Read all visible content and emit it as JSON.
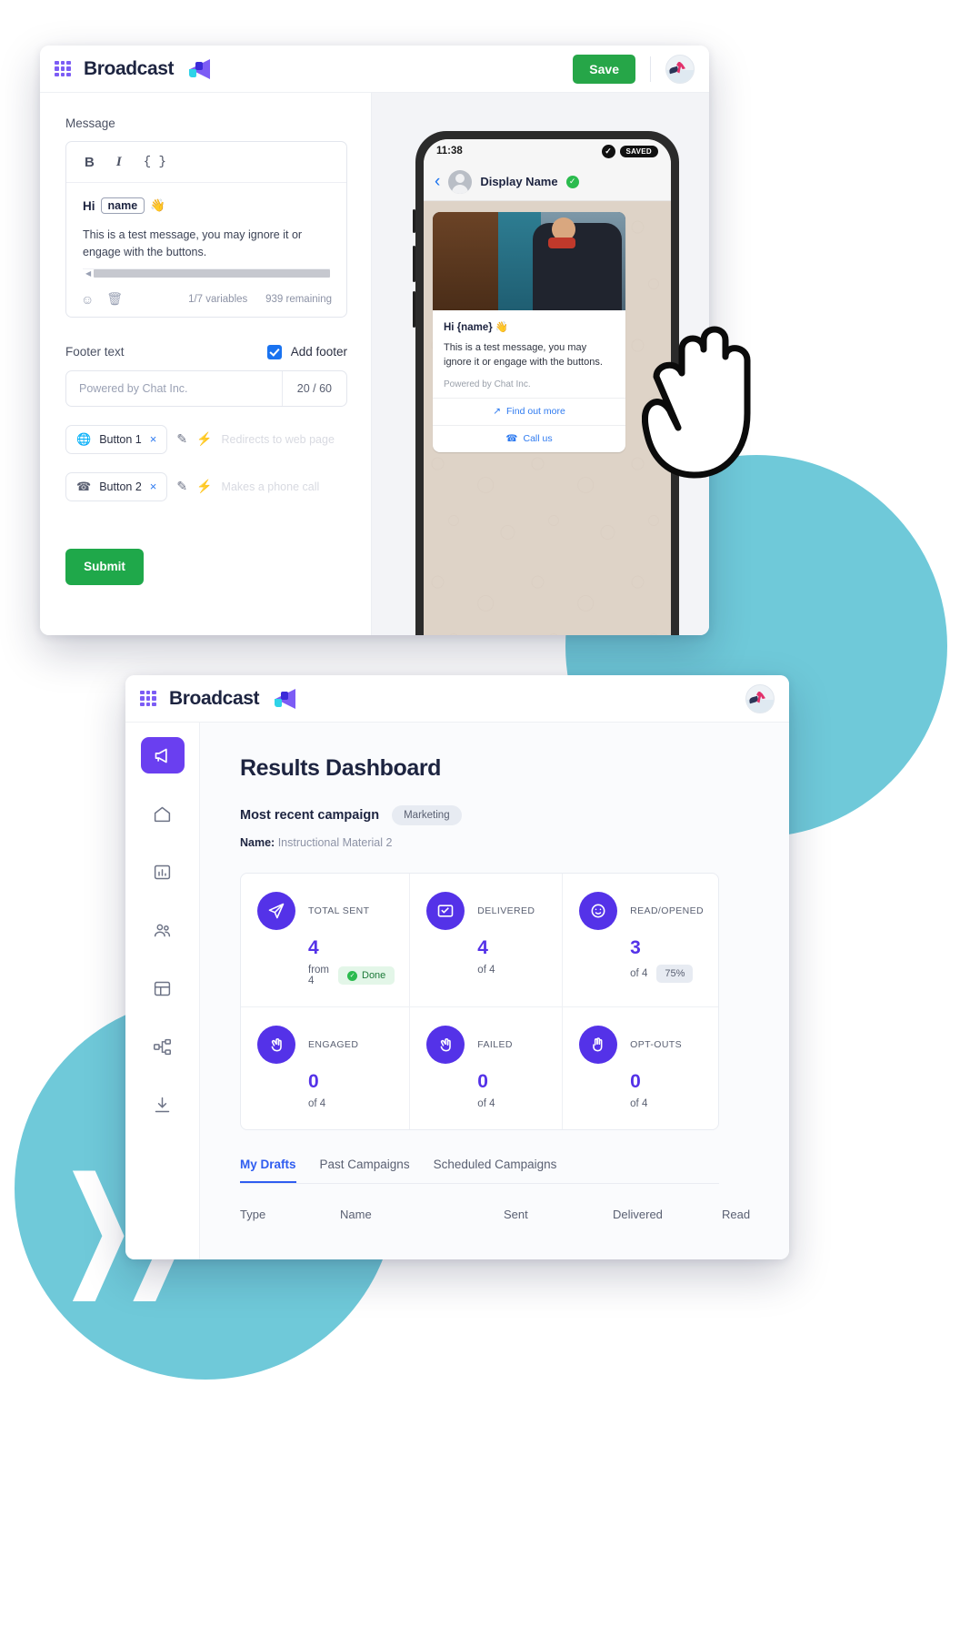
{
  "composer": {
    "titlebar": {
      "brand": "Broadcast",
      "grid_icon": "apps-grid-icon",
      "logo_icon": "megaphone-icon",
      "save_label": "Save",
      "avatar_icon": "user-avatar-skier"
    },
    "message_label": "Message",
    "toolbar": {
      "bold": "B",
      "italic": "I",
      "variables": "{ }"
    },
    "message": {
      "greeting": "Hi",
      "variable_chip": "name",
      "emoji": "👋",
      "body": "This is a test message, you may ignore it or engage with the buttons."
    },
    "editor_footer": {
      "emoji_icon": "emoji-smiley-icon",
      "delete_icon": "trash-icon",
      "variables_count": "1/7 variables",
      "remaining": "939 remaining"
    },
    "footer_section": {
      "label": "Footer text",
      "checkbox_label": "Add footer",
      "checkbox_checked": true,
      "input_value": "Powered by Chat Inc.",
      "counter": "20 / 60"
    },
    "buttons": [
      {
        "icon": "globe-icon",
        "label": "Button 1",
        "remove": "×",
        "hint": "Redirects to web page"
      },
      {
        "icon": "phone-icon",
        "label": "Button 2",
        "remove": "×",
        "hint": "Makes a phone call"
      }
    ],
    "row_icons": {
      "edit": "pencil-icon",
      "action": "lightning-bolt-icon"
    },
    "submit_label": "Submit"
  },
  "phone": {
    "status": {
      "time": "11:38",
      "check_icon": "check-circle-icon",
      "saved_badge": "SAVED"
    },
    "chat_header": {
      "back_icon": "chevron-left-icon",
      "avatar_icon": "contact-avatar-icon",
      "display_name": "Display Name",
      "verified_icon": "verified-badge-icon"
    },
    "bubble": {
      "image_alt": "man-in-puffer-jacket-photo",
      "greeting": "Hi {name}",
      "emoji": "👋",
      "body": "This is a test message, you may ignore it or engage with the buttons.",
      "footer": "Powered by Chat Inc.",
      "actions": [
        {
          "icon": "external-link-icon",
          "label": "Find out more"
        },
        {
          "icon": "phone-icon",
          "label": "Call us"
        }
      ]
    }
  },
  "cursor": {
    "icon": "pointing-hand-cursor"
  },
  "dashboard": {
    "titlebar": {
      "brand": "Broadcast",
      "grid_icon": "apps-grid-icon",
      "logo_icon": "megaphone-icon",
      "avatar_icon": "user-avatar-skier"
    },
    "nav": [
      {
        "name": "broadcast",
        "icon": "megaphone-icon",
        "active": true
      },
      {
        "name": "home",
        "icon": "home-icon",
        "active": false
      },
      {
        "name": "analytics",
        "icon": "bar-chart-icon",
        "active": false
      },
      {
        "name": "contacts",
        "icon": "people-icon",
        "active": false
      },
      {
        "name": "templates",
        "icon": "layout-icon",
        "active": false
      },
      {
        "name": "flows",
        "icon": "sitemap-icon",
        "active": false
      },
      {
        "name": "download",
        "icon": "download-icon",
        "active": false
      }
    ],
    "title": "Results Dashboard",
    "campaign": {
      "label": "Most recent campaign",
      "tag": "Marketing",
      "name_label": "Name:",
      "name_value": "Instructional Material 2"
    },
    "cards": [
      {
        "icon": "paper-plane-icon",
        "title": "TOTAL SENT",
        "value": "4",
        "sub": "from 4",
        "badge": "Done",
        "badge_type": "done"
      },
      {
        "icon": "envelope-check-icon",
        "title": "DELIVERED",
        "value": "4",
        "sub": "of 4",
        "badge": "",
        "badge_type": ""
      },
      {
        "icon": "smiley-icon",
        "title": "READ/OPENED",
        "value": "3",
        "sub": "of 4",
        "badge": "75%",
        "badge_type": "pct"
      },
      {
        "icon": "clap-hands-icon",
        "title": "ENGAGED",
        "value": "0",
        "sub": "of 4",
        "badge": "",
        "badge_type": ""
      },
      {
        "icon": "clap-hands-icon",
        "title": "FAILED",
        "value": "0",
        "sub": "of 4",
        "badge": "",
        "badge_type": ""
      },
      {
        "icon": "raised-hand-icon",
        "title": "OPT-OUTS",
        "value": "0",
        "sub": "of 4",
        "badge": "",
        "badge_type": ""
      }
    ],
    "tabs": [
      {
        "label": "My Drafts",
        "active": true
      },
      {
        "label": "Past Campaigns",
        "active": false
      },
      {
        "label": "Scheduled Campaigns",
        "active": false
      }
    ],
    "table_headers": [
      "Type",
      "Name",
      "Sent",
      "Delivered",
      "Read"
    ]
  },
  "colors": {
    "accent_purple": "#5432e8",
    "nav_active": "#6a3ff0",
    "green": "#26a648",
    "teal": "#6fc9d9",
    "tab_blue": "#2f5df0"
  }
}
